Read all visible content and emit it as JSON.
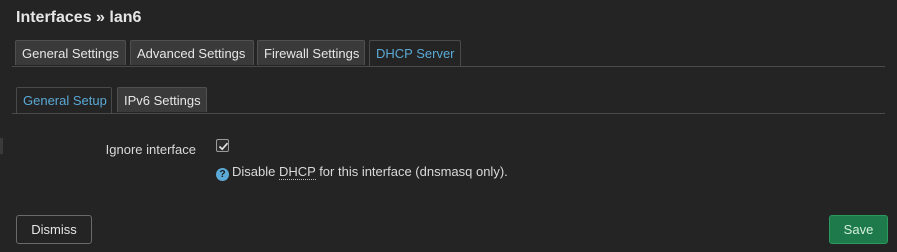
{
  "page": {
    "title": "Interfaces » lan6"
  },
  "primary_tabs": [
    {
      "label": "General Settings",
      "active": false
    },
    {
      "label": "Advanced Settings",
      "active": false
    },
    {
      "label": "Firewall Settings",
      "active": false
    },
    {
      "label": "DHCP Server",
      "active": true
    }
  ],
  "secondary_tabs": [
    {
      "label": "General Setup",
      "active": true
    },
    {
      "label": "IPv6 Settings",
      "active": false
    }
  ],
  "form": {
    "ignore_interface": {
      "label": "Ignore interface",
      "checked": true,
      "help_prefix": "Disable ",
      "help_abbr": "DHCP",
      "help_suffix": " for this interface (dnsmasq only).",
      "help_icon": "question-icon"
    }
  },
  "actions": {
    "dismiss_label": "Dismiss",
    "save_label": "Save"
  },
  "colors": {
    "accent": "#5aa9d6",
    "save": "#1e7a4a",
    "background": "#242424"
  }
}
